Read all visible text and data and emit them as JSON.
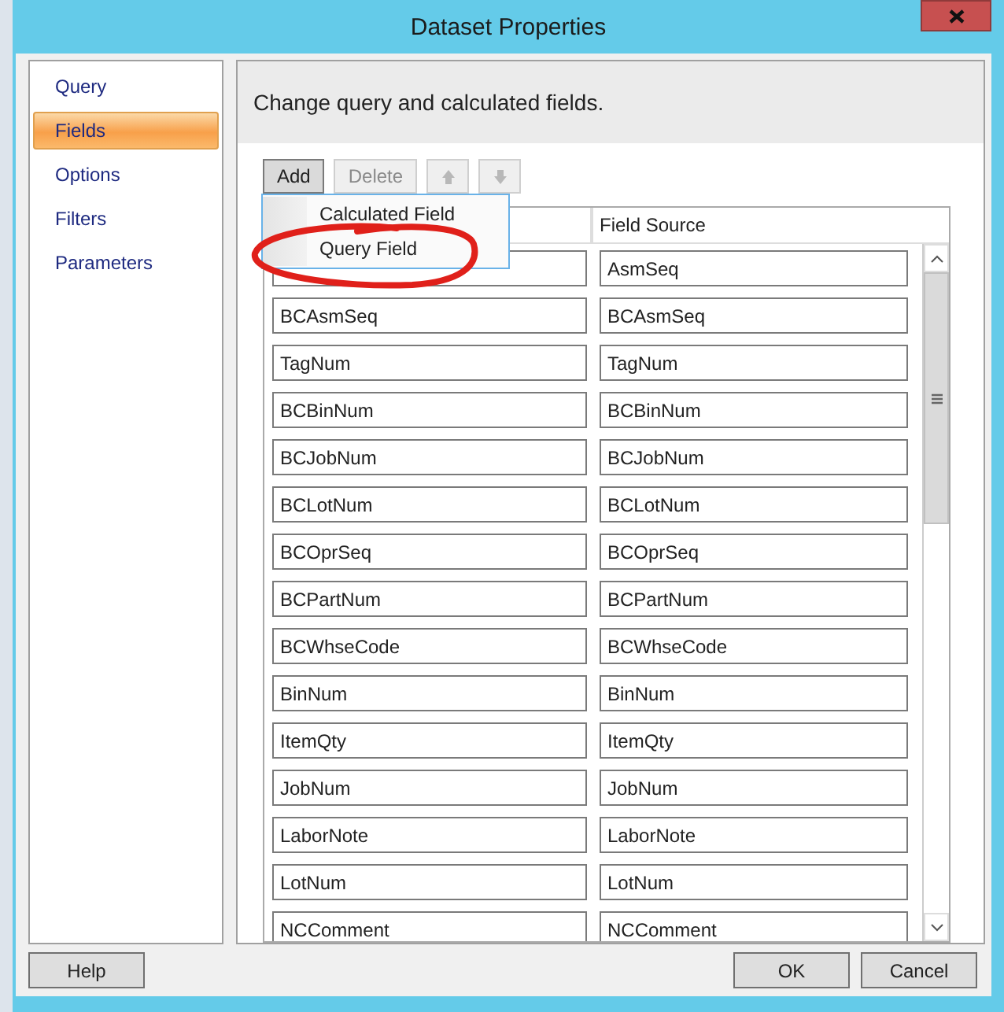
{
  "window": {
    "title": "Dataset Properties"
  },
  "nav": [
    {
      "label": "Query",
      "selected": false
    },
    {
      "label": "Fields",
      "selected": true
    },
    {
      "label": "Options",
      "selected": false
    },
    {
      "label": "Filters",
      "selected": false
    },
    {
      "label": "Parameters",
      "selected": false
    }
  ],
  "header": "Change query and calculated fields.",
  "toolbar": [
    {
      "kind": "text",
      "label": "Add",
      "disabled": false,
      "pressed": true
    },
    {
      "kind": "text",
      "label": "Delete",
      "disabled": true,
      "pressed": false
    },
    {
      "kind": "up",
      "disabled": true,
      "pressed": false
    },
    {
      "kind": "down",
      "disabled": true,
      "pressed": false
    }
  ],
  "menu": [
    {
      "label": "Calculated Field",
      "circled": false
    },
    {
      "label": "Query Field",
      "circled": true
    }
  ],
  "grid": {
    "column_2_header": "Field Source",
    "rows": [
      {
        "source": "AsmSeq"
      },
      {
        "name": "BCAsmSeq",
        "source": "BCAsmSeq"
      },
      {
        "name": "TagNum",
        "source": "TagNum"
      },
      {
        "name": "BCBinNum",
        "source": "BCBinNum"
      },
      {
        "name": "BCJobNum",
        "source": "BCJobNum"
      },
      {
        "name": "BCLotNum",
        "source": "BCLotNum"
      },
      {
        "name": "BCOprSeq",
        "source": "BCOprSeq"
      },
      {
        "name": "BCPartNum",
        "source": "BCPartNum"
      },
      {
        "name": "BCWhseCode",
        "source": "BCWhseCode"
      },
      {
        "name": "BinNum",
        "source": "BinNum"
      },
      {
        "name": "ItemQty",
        "source": "ItemQty"
      },
      {
        "name": "JobNum",
        "source": "JobNum"
      },
      {
        "name": "LaborNote",
        "source": "LaborNote"
      },
      {
        "name": "LotNum",
        "source": "LotNum"
      },
      {
        "name": "NCComment",
        "source": "NCComment"
      }
    ]
  },
  "buttons": {
    "help": "Help",
    "ok": "OK",
    "cancel": "Cancel"
  }
}
